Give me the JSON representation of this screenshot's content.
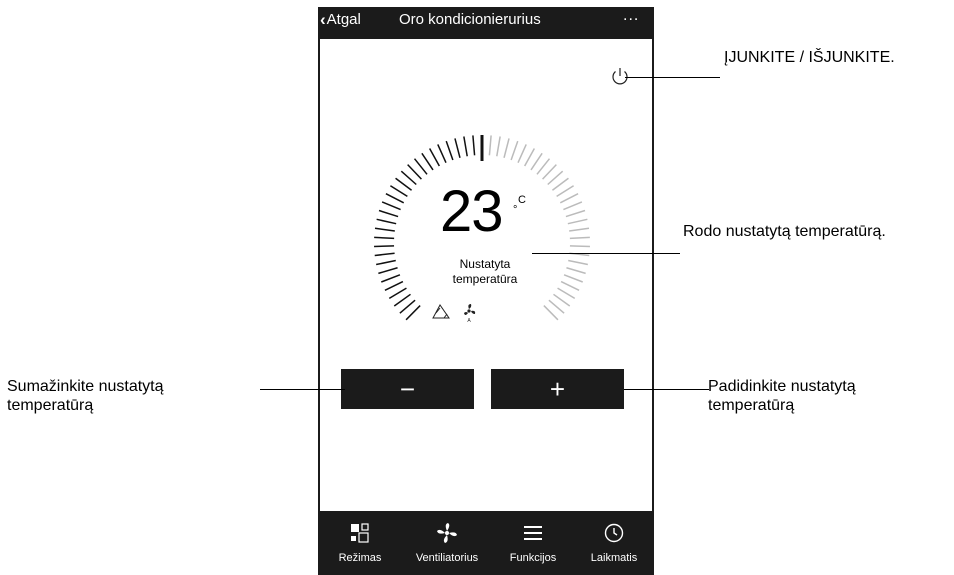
{
  "header": {
    "back_label": "Atgal",
    "title": "Oro kondicionierurius",
    "more_label": "..."
  },
  "thermostat": {
    "temperature": "23",
    "unit_letter": "C",
    "unit_degree": "°",
    "set_label_line1": "Nustatyta",
    "set_label_line2": "temperatūra"
  },
  "controls": {
    "minus_label": "−",
    "plus_label": "+"
  },
  "nav": {
    "items": [
      {
        "label": "Režimas",
        "icon": "mode-icon"
      },
      {
        "label": "Ventiliatorius",
        "icon": "fan-icon"
      },
      {
        "label": "Funkcijos",
        "icon": "menu-icon"
      },
      {
        "label": "Laikmatis",
        "icon": "clock-icon"
      }
    ]
  },
  "callouts": {
    "power": "ĮJUNKITE / IŠJUNKITE.",
    "temperature": "Rodo nustatytą temperatūrą.",
    "decrease_line1": "Sumažinkite nustatytą",
    "decrease_line2": "temperatūrą",
    "increase_line1": "Padidinkite nustatytą",
    "increase_line2": "temperatūrą"
  },
  "colors": {
    "frame": "#1b1b1b",
    "screen": "#ffffff",
    "tick_dark": "#111111",
    "tick_light": "#bbbbbb"
  }
}
